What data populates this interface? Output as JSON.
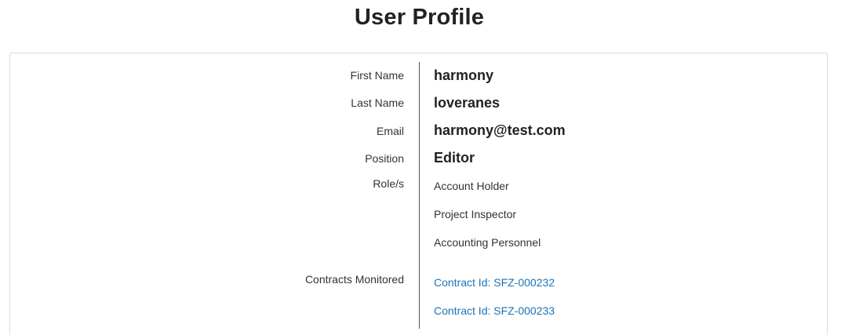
{
  "page": {
    "title": "User Profile"
  },
  "profile": {
    "first_name": {
      "label": "First Name",
      "value": "harmony"
    },
    "last_name": {
      "label": "Last Name",
      "value": "loveranes"
    },
    "email": {
      "label": "Email",
      "value": "harmony@test.com"
    },
    "position": {
      "label": "Position",
      "value": "Editor"
    },
    "roles": {
      "label": "Role/s",
      "items": [
        "Account Holder",
        "Project Inspector",
        "Accounting Personnel"
      ]
    },
    "contracts": {
      "label": "Contracts Monitored",
      "items": [
        "Contract Id: SFZ-000232",
        "Contract Id: SFZ-000233"
      ]
    }
  },
  "colors": {
    "link": "#1a73b8",
    "divider": "#555555",
    "card_border": "#dcdcdc"
  }
}
